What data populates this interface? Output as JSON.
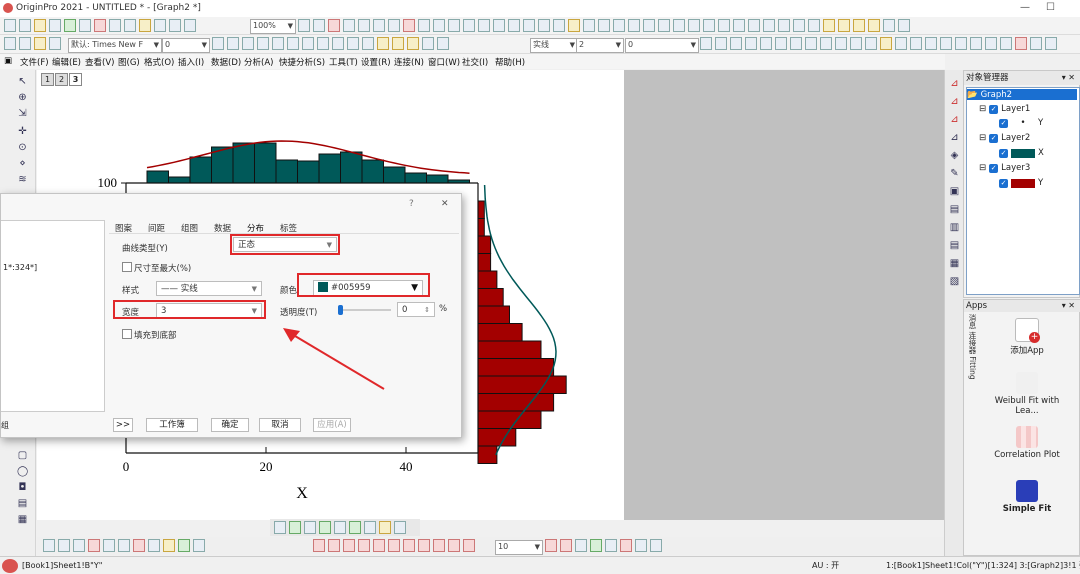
{
  "window": {
    "title": "OriginPro 2021 - UNTITLED * - [Graph2 *]"
  },
  "toolbar": {
    "zoom": "100%",
    "font_name": "默认: Times New F",
    "font_size": "0",
    "line_style": "实线",
    "line_width": "2",
    "bottom_size": "10"
  },
  "menu": {
    "items": [
      "文件(F)",
      "编辑(E)",
      "查看(V)",
      "图(G)",
      "格式(O)",
      "插入(I)",
      "数据(D)",
      "分析(A)",
      "快捷分析(S)",
      "工具(T)",
      "设置(R)",
      "连接(N)",
      "窗口(W)",
      "社交(I)",
      "帮助(H)"
    ]
  },
  "layer_tabs": [
    "1",
    "2",
    "3"
  ],
  "chart_data": {
    "type": "bar",
    "description_series": [
      {
        "name": "Layer2",
        "orientation": "vertical",
        "color": "#005959",
        "bins_x": [
          2,
          5,
          8,
          11,
          14,
          17,
          20,
          23,
          26,
          29,
          32,
          35,
          38,
          41,
          44
        ],
        "heights": [
          12,
          6,
          26,
          36,
          40,
          40,
          23,
          22,
          29,
          31,
          23,
          16,
          10,
          8,
          3
        ]
      },
      {
        "name": "Layer3",
        "orientation": "horizontal",
        "color": "#a30000",
        "lengths": [
          1,
          1,
          2,
          2,
          3,
          4,
          5,
          7,
          10,
          12,
          14,
          12,
          10,
          6,
          3
        ]
      }
    ],
    "xlabel": "X",
    "x_ticks": [
      "0",
      "20",
      "40"
    ],
    "y_ticks": [
      "100"
    ],
    "xlim": [
      0,
      50
    ],
    "fit_curve": "正态"
  },
  "dialog": {
    "tabs": [
      "图案",
      "间距",
      "组图",
      "数据",
      "分布",
      "标签"
    ],
    "active_tab": "分布",
    "left_text": "1*:324*]",
    "left_bottom": "组",
    "curve_type_label": "曲线类型(Y)",
    "curve_type_value": "正态",
    "size_max_label": "尺寸至最大(%)",
    "style_label": "样式",
    "style_value": "实线",
    "color_label": "颜色",
    "color_value": "#005959",
    "width_label": "宽度",
    "width_value": "3",
    "transparency_label": "透明度(T)",
    "transparency_value": "0",
    "transparency_unit": "%",
    "fill_label": "填充到底部",
    "btn_expand": ">>",
    "btn_workbook": "工作簿",
    "btn_ok": "确定",
    "btn_cancel": "取消",
    "btn_apply": "应用(A)",
    "help": "?",
    "close": "✕"
  },
  "object_manager": {
    "title": "对象管理器",
    "root": "Graph2",
    "layers": [
      {
        "name": "Layer1",
        "plot": "Y",
        "color": "#000000"
      },
      {
        "name": "Layer2",
        "plot": "X",
        "color": "#005959"
      },
      {
        "name": "Layer3",
        "plot": "Y",
        "color": "#a30000"
      }
    ]
  },
  "apps": {
    "title": "Apps",
    "items": [
      "添加App",
      "Weibull Fit with Lea...",
      "Correlation Plot",
      "Simple Fit"
    ],
    "side_labels": [
      "消息",
      "连接器",
      "Fitting"
    ]
  },
  "statusbar": {
    "left": "[Book1]Sheet1!B\"Y\"",
    "au": "AU : 开",
    "right": "1:[Book1]Sheet1!Col(\"Y\")[1:324]  3:[Graph2]3!1  弧度"
  },
  "colors": {
    "accent_red": "#e0282a",
    "teal": "#005959",
    "dark_red": "#a30000"
  }
}
